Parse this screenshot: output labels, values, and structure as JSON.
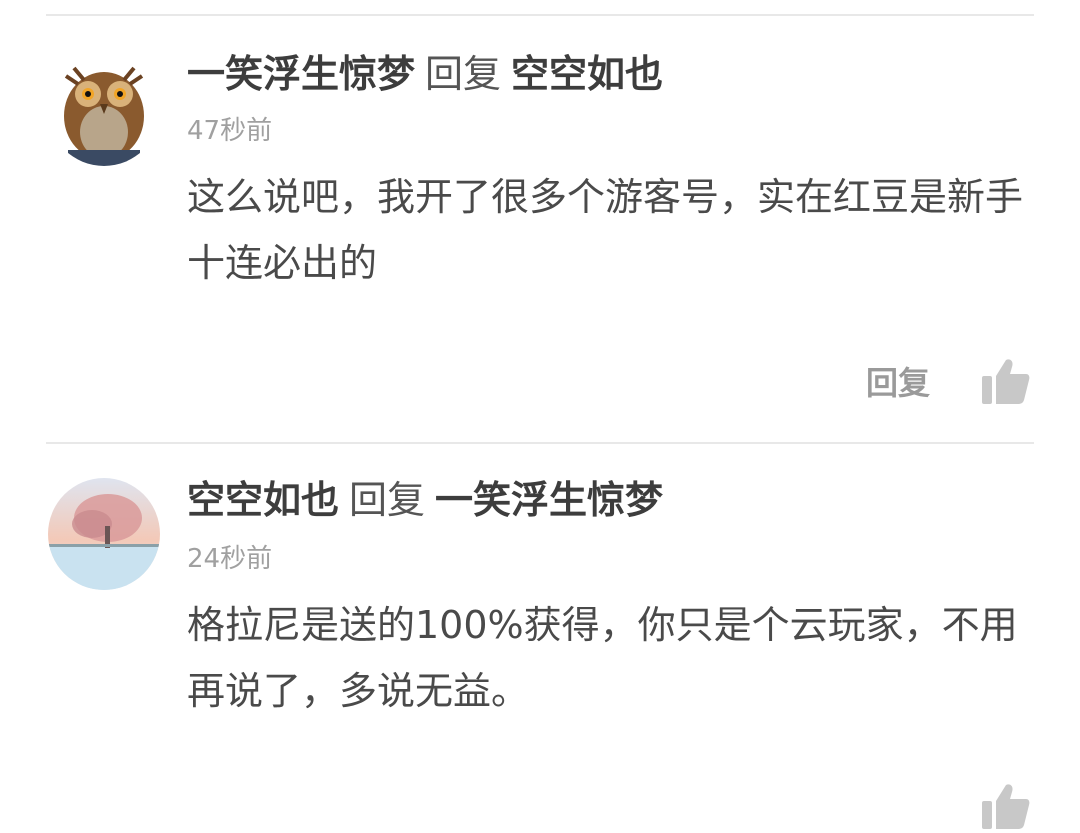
{
  "comments": [
    {
      "author": "一笑浮生惊梦",
      "reply_word": "回复",
      "reply_to": "空空如也",
      "time": "47秒前",
      "text": "这么说吧，我开了很多个游客号，实在红豆是新手十连必出的",
      "reply_label": "回复",
      "avatar_icon": "owl-avatar",
      "like_icon": "thumbs-up-icon"
    },
    {
      "author": "空空如也",
      "reply_word": "回复",
      "reply_to": "一笑浮生惊梦",
      "time": "24秒前",
      "text": "格拉尼是送的100%获得，你只是个云玩家，不用再说了，多说无益。",
      "avatar_icon": "winter-tree-avatar",
      "like_icon": "thumbs-up-icon"
    }
  ],
  "colors": {
    "text_primary": "#3d3d3d",
    "text_secondary": "#a0a0a0",
    "divider": "#e8e8e8",
    "icon": "#c8c8c8"
  }
}
